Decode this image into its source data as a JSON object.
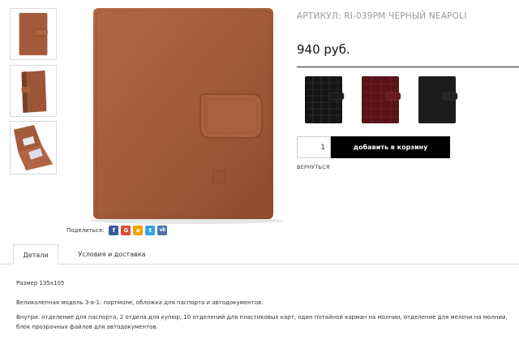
{
  "product": {
    "sku": "АРТИКУЛ: RI-039PM ЧЕРНЫЙ NEAPOLI",
    "price": "940 руб.",
    "quantity": "1",
    "add_to_cart": "добавить в корзину",
    "back": "ВЕРНУТЬСЯ"
  },
  "thumbnails": [
    {
      "alt": "wallet-front"
    },
    {
      "alt": "wallet-side"
    },
    {
      "alt": "wallet-open"
    }
  ],
  "variants": [
    {
      "color": "#141414",
      "name": "black-croc"
    },
    {
      "color": "#5a1418",
      "name": "bordeaux-croc"
    },
    {
      "color": "#1c1c1c",
      "name": "black-smooth"
    }
  ],
  "share": {
    "label": "Поделиться:",
    "buttons": [
      {
        "icon": "facebook-icon",
        "glyph": "f",
        "color": "#3b5998"
      },
      {
        "icon": "google-plus-icon",
        "glyph": "G",
        "color": "#dd4b39"
      },
      {
        "icon": "odnoklassniki-icon",
        "glyph": "о",
        "color": "#f2a000"
      },
      {
        "icon": "twitter-icon",
        "glyph": "t",
        "color": "#36a3de"
      },
      {
        "icon": "vk-icon",
        "glyph": "vk",
        "color": "#4a76a8"
      }
    ]
  },
  "tabs": [
    "Детали",
    "Условия и доставка"
  ],
  "description": {
    "size": "Размер 135x105",
    "model": "Великолепная модель 3-в-1: портмоне, обложка для паспорта и автодокументов.",
    "inside": "Внутри: отделение для паспорта, 2 отдела для купюр, 10 отделений для пластиковых карт, один потайной карман на молнии, отделение для мелочи на молнии, блок прозрачных файлов для автодокументов."
  },
  "colors": {
    "leather": "#a05a3a",
    "button": "#000000",
    "muted_text": "#9a9a9a"
  }
}
